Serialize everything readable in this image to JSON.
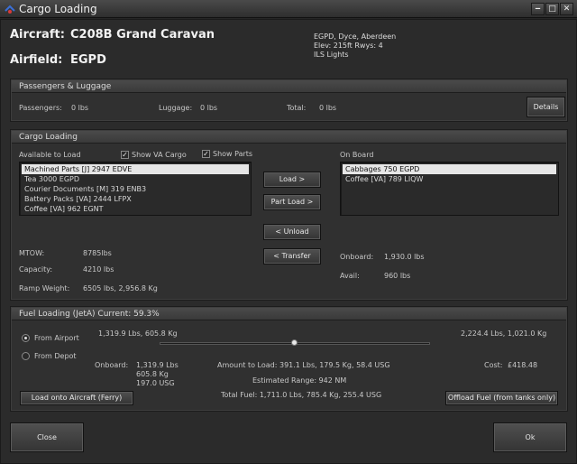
{
  "window": {
    "title": "Cargo Loading",
    "minimize_glyph": "‒",
    "maximize_glyph": "□",
    "close_glyph": "✕"
  },
  "header": {
    "aircraft_label": "Aircraft:",
    "aircraft_value": "C208B Grand Caravan",
    "airfield_label": "Airfield:",
    "airfield_value": "EGPD",
    "airfield_info": [
      "EGPD, Dyce, Aberdeen",
      "Elev: 215ft Rwys: 4",
      "ILS Lights"
    ]
  },
  "passengers": {
    "title": "Passengers & Luggage",
    "passengers_label": "Passengers:",
    "passengers_value": "0 lbs",
    "luggage_label": "Luggage:",
    "luggage_value": "0 lbs",
    "total_label": "Total:",
    "total_value": "0 lbs",
    "details_button": "Details"
  },
  "cargo": {
    "title": "Cargo Loading",
    "available_label": "Available to Load",
    "show_va_cargo_label": "Show VA Cargo",
    "show_va_cargo_checked": true,
    "show_parts_label": "Show Parts",
    "show_parts_checked": true,
    "available_items": [
      "Machined Parts [J]    2947    EDVE",
      "Tea    3000    EGPD",
      "Courier Documents [M]    319    ENB3",
      "Battery Packs [VA]    2444    LFPX",
      "Coffee [VA]    962    EGNT"
    ],
    "onboard_label": "On Board",
    "onboard_items": [
      "Cabbages    750    EGPD",
      "Coffee [VA]    789    LIQW"
    ],
    "load_button": "Load >",
    "part_load_button": "Part Load >",
    "unload_button": "< Unload",
    "transfer_button": "< Transfer",
    "mtow_label": "MTOW:",
    "mtow_value": "8785lbs",
    "capacity_label": "Capacity:",
    "capacity_value": "4210 lbs",
    "ramp_weight_label": "Ramp Weight:",
    "ramp_weight_value": "6505 lbs, 2,956.8 Kg",
    "onboard_weight_label": "Onboard:",
    "onboard_weight_value": "1,930.0 lbs",
    "avail_label": "Avail:",
    "avail_value": "960 lbs"
  },
  "fuel": {
    "title": "Fuel Loading (JetA)   Current: 59.3%",
    "from_airport_label": "From Airport",
    "from_depot_label": "From Depot",
    "selected_source": "airport",
    "slider_min_label": "1,319.9 Lbs, 605.8 Kg",
    "slider_max_label": "2,224.4 Lbs, 1,021.0 Kg",
    "slider_fraction": 0.5,
    "onboard_label": "Onboard:",
    "onboard_lines": [
      "1,319.9 Lbs",
      "605.8 Kg",
      "197.0 USG"
    ],
    "amount_to_load": "Amount to Load: 391.1 Lbs, 179.5 Kg, 58.4 USG",
    "estimated_range": "Estimated Range: 942 NM",
    "total_fuel": "Total Fuel: 1,711.0 Lbs, 785.4 Kg, 255.4 USG",
    "cost_label": "Cost:",
    "cost_value": "£418.48",
    "load_button": "Load onto Aircraft (Ferry)",
    "offload_button": "Offload Fuel (from tanks only)"
  },
  "footer": {
    "close_button": "Close",
    "ok_button": "Ok"
  },
  "colors": {
    "app_icon_blue": "#3a6fd8",
    "app_icon_red": "#d83a3a"
  }
}
